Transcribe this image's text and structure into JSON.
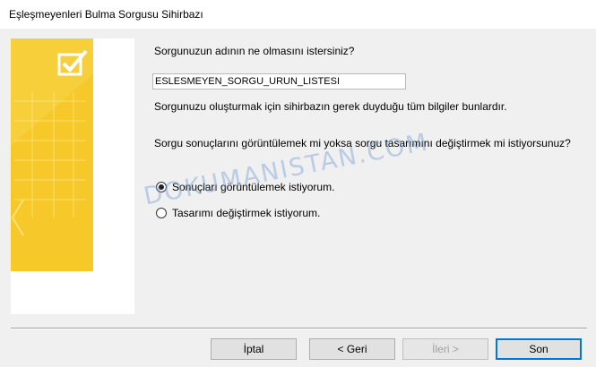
{
  "window": {
    "title": "Eşleşmeyenleri Bulma Sorgusu Sihirbazı"
  },
  "banner": {
    "icon": "checklist-icon",
    "color": "#f4c41f"
  },
  "form": {
    "question_name": "Sorgunuzun adının ne olmasını istersiniz?",
    "query_name_value": "ESLESMEYEN_SORGU_URUN_LISTESI",
    "info_text": "Sorgunuzu oluşturmak için sihirbazın gerek duyduğu tüm bilgiler bunlardır.",
    "question_view": "Sorgu sonuçlarını görüntülemek mi yoksa sorgu tasarımını değiştirmek mi istiyorsunuz?",
    "options": [
      {
        "label": "Sonuçları görüntülemek istiyorum.",
        "checked": true
      },
      {
        "label": "Tasarımı değiştirmek istiyorum.",
        "checked": false
      }
    ]
  },
  "watermark": "DOKUMANISTAN.COM",
  "buttons": {
    "cancel": "İptal",
    "back": "< Geri",
    "next": "İleri >",
    "finish": "Son"
  }
}
